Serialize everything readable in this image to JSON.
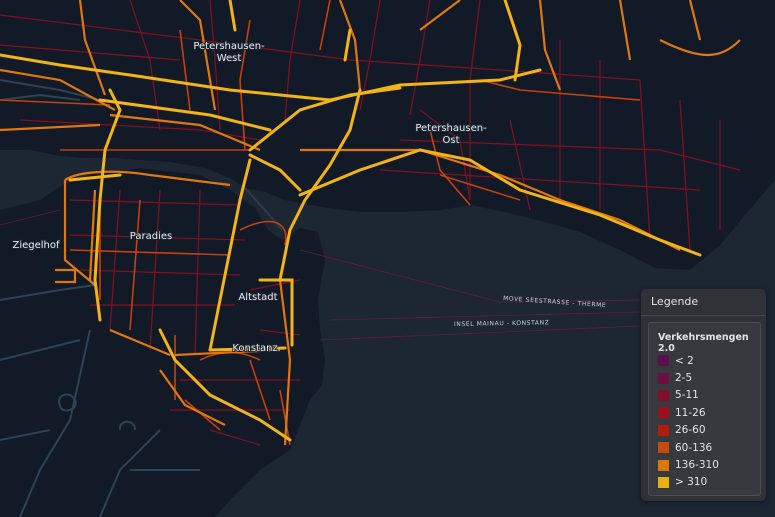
{
  "map": {
    "labels": {
      "petershausen_west": [
        "Petershausen-",
        "West"
      ],
      "petershausen_ost": [
        "Petershausen-",
        "Ost"
      ],
      "paradies": "Paradies",
      "altstadt": "Altstadt",
      "konstanz": "Konstanz",
      "ziegelhof": "Ziegelhof"
    },
    "routes": {
      "ferry1": "MOVE SEESTRASSE - THERME",
      "ferry2": "INSEL MAINAU - KONSTANZ"
    }
  },
  "legend": {
    "title": "Legende",
    "layer_name": "Verkehrsmengen 2.0",
    "items": [
      {
        "label": "< 2",
        "color": "#5c0f4a"
      },
      {
        "label": "2-5",
        "color": "#6f0d40"
      },
      {
        "label": "5-11",
        "color": "#860c2c"
      },
      {
        "label": "11-26",
        "color": "#9e0e1c"
      },
      {
        "label": "26-60",
        "color": "#b31d10"
      },
      {
        "label": "60-136",
        "color": "#c84a0c"
      },
      {
        "label": "136-310",
        "color": "#d9780d"
      },
      {
        "label": "> 310",
        "color": "#e8b012"
      }
    ]
  }
}
